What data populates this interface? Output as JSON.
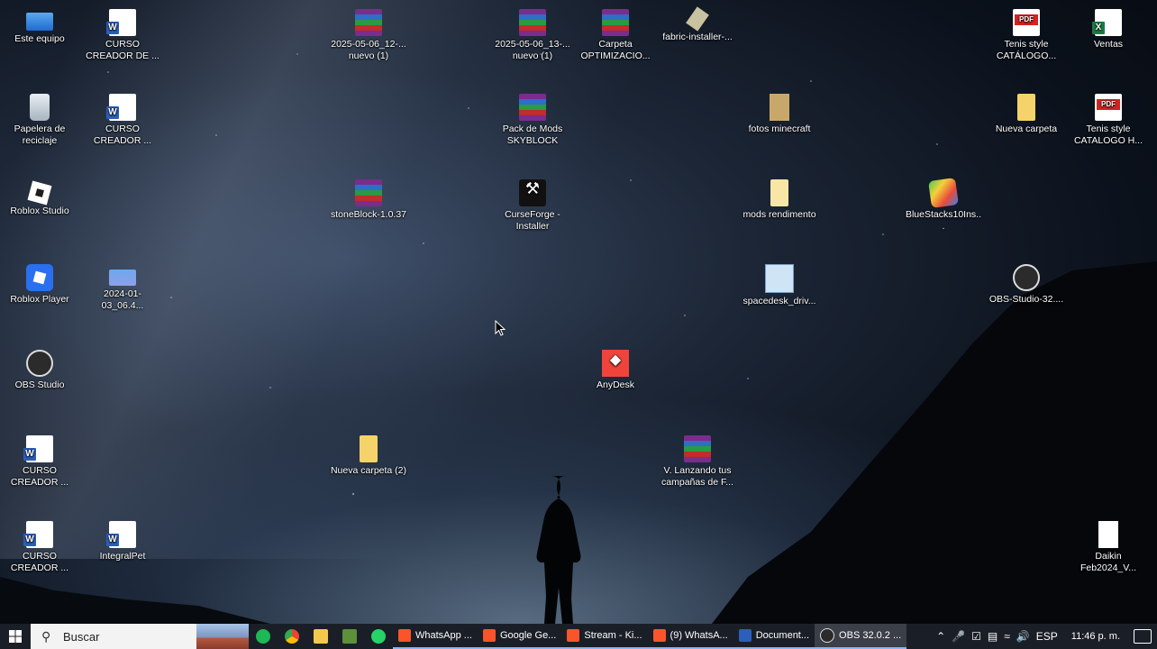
{
  "desktop": {
    "icons": [
      {
        "label": "Este equipo",
        "icon": "computer-icon"
      },
      {
        "label": "CURSO CREADOR DE ...",
        "icon": "word-document-icon"
      },
      {
        "label": "2025-05-06_12-... nuevo (1)",
        "icon": "winrar-archive-icon"
      },
      {
        "label": "2025-05-06_13-... nuevo (1)",
        "icon": "winrar-archive-icon"
      },
      {
        "label": "Carpeta OPTIMIZACIO...",
        "icon": "winrar-archive-icon"
      },
      {
        "label": "fabric-installer-...",
        "icon": "java-installer-icon"
      },
      {
        "label": "Tenis style CATÁLOGO...",
        "icon": "pdf-icon"
      },
      {
        "label": "Ventas",
        "icon": "excel-icon"
      },
      {
        "label": "Papelera de reciclaje",
        "icon": "recycle-bin-icon"
      },
      {
        "label": "CURSO CREADOR ...",
        "icon": "word-document-icon"
      },
      {
        "label": "Pack de Mods SKYBLOCK",
        "icon": "winrar-archive-icon"
      },
      {
        "label": "fotos minecraft",
        "icon": "minecraft-folder-icon"
      },
      {
        "label": "Nueva carpeta",
        "icon": "folder-icon"
      },
      {
        "label": "Tenis style CATALOGO H...",
        "icon": "pdf-icon"
      },
      {
        "label": "Roblox Studio",
        "icon": "roblox-studio-icon"
      },
      {
        "label": "stoneBlock-1.0.37",
        "icon": "winrar-archive-icon"
      },
      {
        "label": "CurseForge - Installer",
        "icon": "curseforge-icon"
      },
      {
        "label": "mods rendimento",
        "icon": "folder-icon"
      },
      {
        "label": "BlueStacks10Ins...",
        "icon": "bluestacks-icon"
      },
      {
        "label": "Roblox Player",
        "icon": "roblox-icon"
      },
      {
        "label": "2024-01-03_06.4...",
        "icon": "image-file-icon"
      },
      {
        "label": "spacedesk_driv...",
        "icon": "spacedesk-installer-icon"
      },
      {
        "label": "OBS-Studio-32....",
        "icon": "obs-installer-icon"
      },
      {
        "label": "OBS Studio",
        "icon": "obs-icon"
      },
      {
        "label": "AnyDesk",
        "icon": "anydesk-icon"
      },
      {
        "label": "CURSO CREADOR ...",
        "icon": "word-document-icon"
      },
      {
        "label": "Nueva carpeta (2)",
        "icon": "folder-icon"
      },
      {
        "label": "V. Lanzando tus campañas de F...",
        "icon": "winrar-archive-icon"
      },
      {
        "label": "CURSO CREADOR ...",
        "icon": "word-document-icon"
      },
      {
        "label": "IntegralPet",
        "icon": "word-document-icon"
      },
      {
        "label": "Daikin Feb2024_V...",
        "icon": "document-icon"
      }
    ]
  },
  "taskbar": {
    "search_placeholder": "Buscar",
    "pinned": [
      {
        "icon": "spotify-icon",
        "color": "#1DB954"
      },
      {
        "icon": "chrome-icon",
        "color": "#4285F4"
      },
      {
        "icon": "file-explorer-icon",
        "color": "#F2C94C"
      },
      {
        "icon": "minecraft-launcher-icon",
        "color": "#5E8F3A"
      },
      {
        "icon": "whatsapp-icon",
        "color": "#25D366"
      }
    ],
    "apps": [
      {
        "label": "WhatsApp ...",
        "icon": "brave-icon",
        "color": "#FB542B"
      },
      {
        "label": "Google Ge...",
        "icon": "brave-icon",
        "color": "#FB542B"
      },
      {
        "label": "Stream - Ki...",
        "icon": "brave-icon",
        "color": "#FB542B"
      },
      {
        "label": "(9) WhatsA...",
        "icon": "brave-icon",
        "color": "#FB542B"
      },
      {
        "label": "Document...",
        "icon": "word-icon",
        "color": "#2B5FB9"
      },
      {
        "label": "OBS 32.0.2 ...",
        "icon": "obs-icon",
        "color": "#DCDCDC"
      }
    ],
    "tray": {
      "language": "ESP",
      "time": "11:46 p. m."
    }
  }
}
